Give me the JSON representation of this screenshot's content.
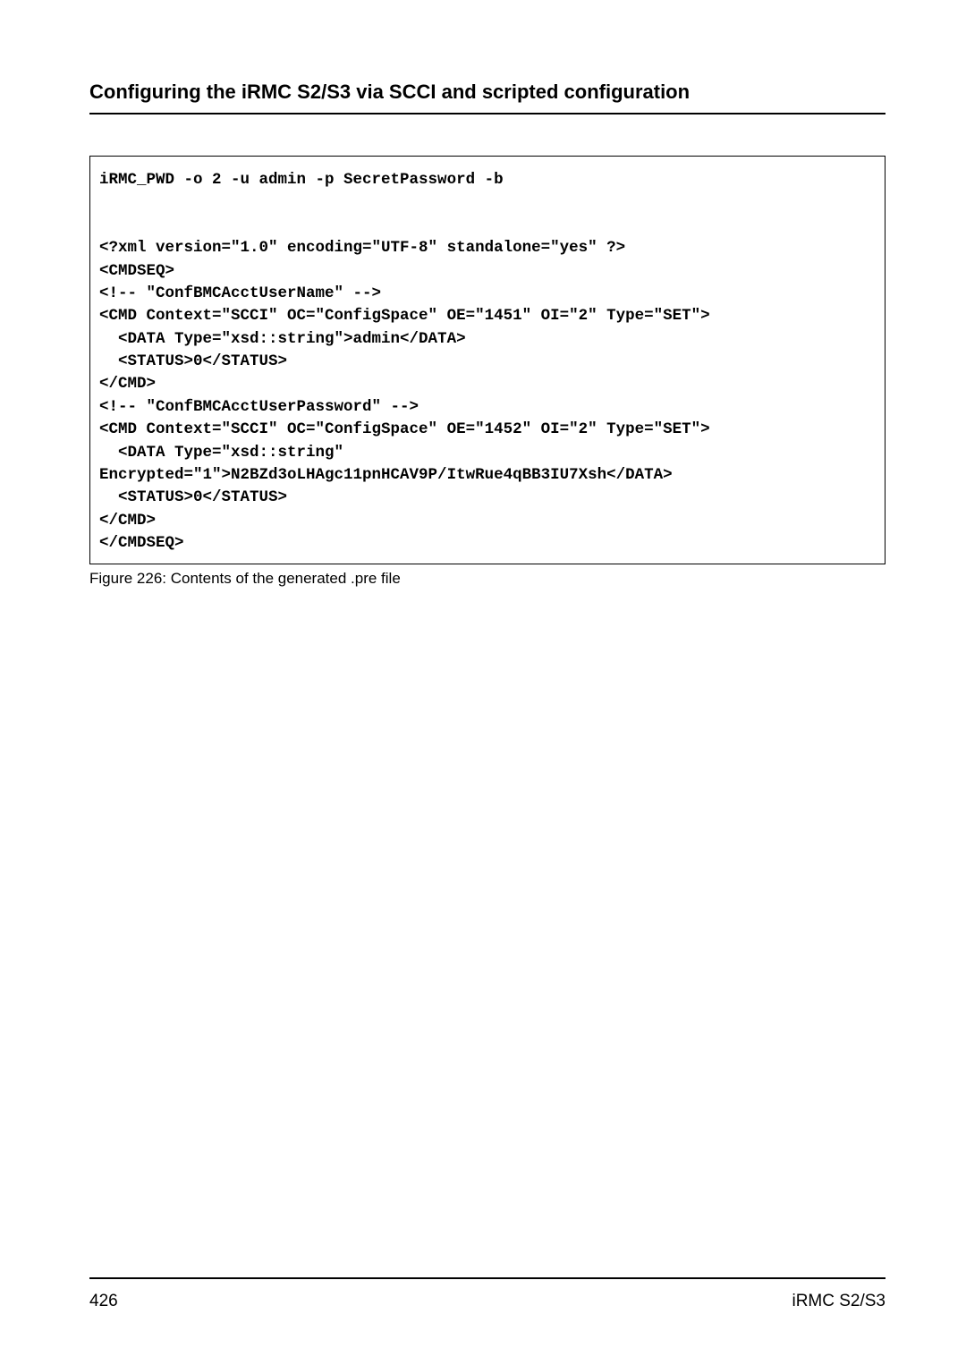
{
  "header": {
    "title": "Configuring the iRMC S2/S3 via SCCI and scripted configuration"
  },
  "code": {
    "line1": "iRMC_PWD -o 2 -u admin -p SecretPassword -b",
    "blank1": "",
    "blank2": "",
    "line2": "<?xml version=\"1.0\" encoding=\"UTF-8\" standalone=\"yes\" ?>",
    "line3": "<CMDSEQ>",
    "line4": "<!-- \"ConfBMCAcctUserName\" -->",
    "line5": "<CMD Context=\"SCCI\" OC=\"ConfigSpace\" OE=\"1451\" OI=\"2\" Type=\"SET\">",
    "line6": "  <DATA Type=\"xsd::string\">admin</DATA>",
    "line7": "  <STATUS>0</STATUS>",
    "line8": "</CMD>",
    "line9": "<!-- \"ConfBMCAcctUserPassword\" -->",
    "line10": "<CMD Context=\"SCCI\" OC=\"ConfigSpace\" OE=\"1452\" OI=\"2\" Type=\"SET\">",
    "line11": "  <DATA Type=\"xsd::string\" ",
    "line12": "Encrypted=\"1\">N2BZd3oLHAgc11pnHCAV9P/ItwRue4qBB3IU7Xsh</DATA>",
    "line13": "  <STATUS>0</STATUS>",
    "line14": "</CMD>",
    "line15": "</CMDSEQ>"
  },
  "figure_caption": "Figure 226: Contents of the generated .pre file",
  "footer": {
    "page_number": "426",
    "doc_name": "iRMC S2/S3"
  }
}
